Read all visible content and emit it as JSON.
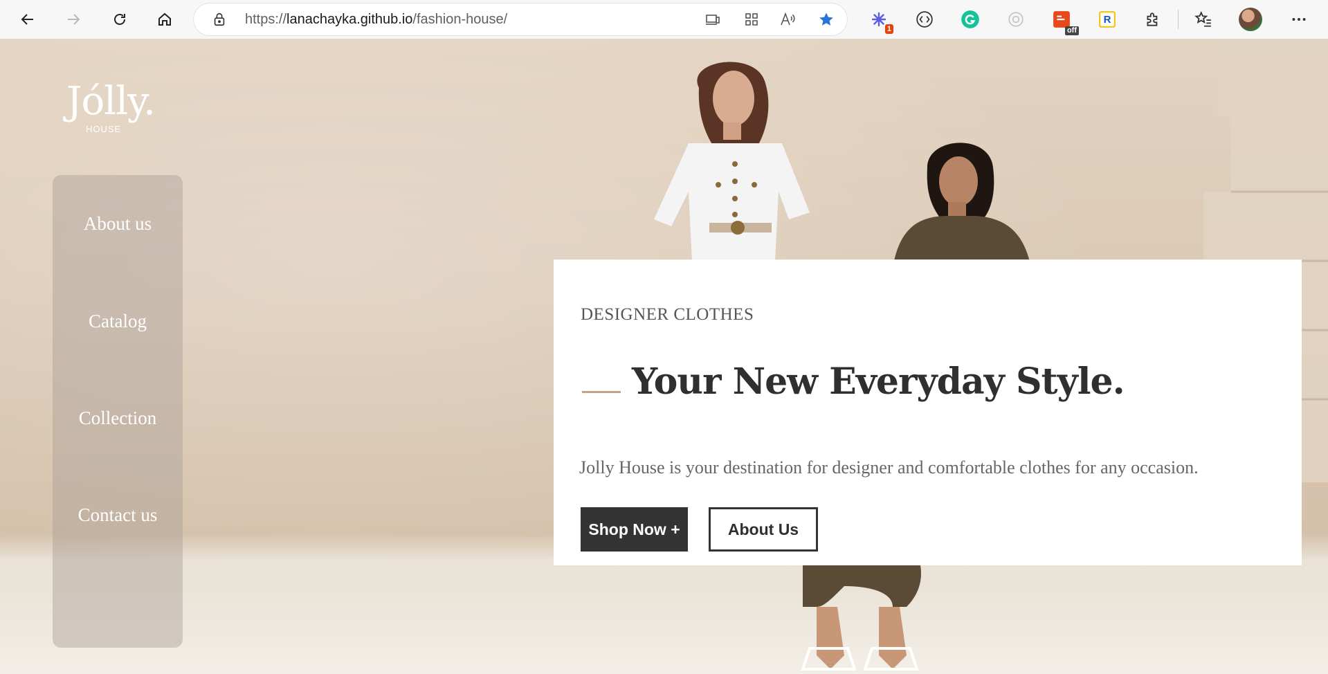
{
  "browser": {
    "url_prefix": "https://",
    "url_host": "lanachayka.github.io",
    "url_path": "/fashion-house/",
    "extensions": {
      "badge_count": "1",
      "badge_off": "off",
      "r_ext_letter": "R"
    }
  },
  "site": {
    "logo": "Jólly.",
    "logo_sub": "HOUSE"
  },
  "nav": {
    "items": [
      "About us",
      "Catalog",
      "Collection",
      "Contact us"
    ]
  },
  "hero": {
    "eyebrow": "DESIGNER CLOTHES",
    "headline": "Your New Everyday Style.",
    "lead": "Jolly House is your destination for designer and comfortable clothes for any occasion.",
    "primary_cta": "Shop Now +",
    "secondary_cta": "About Us"
  },
  "colors": {
    "accent_line": "#c2a38c",
    "button_dark": "#333333",
    "background": "#dccab6"
  }
}
